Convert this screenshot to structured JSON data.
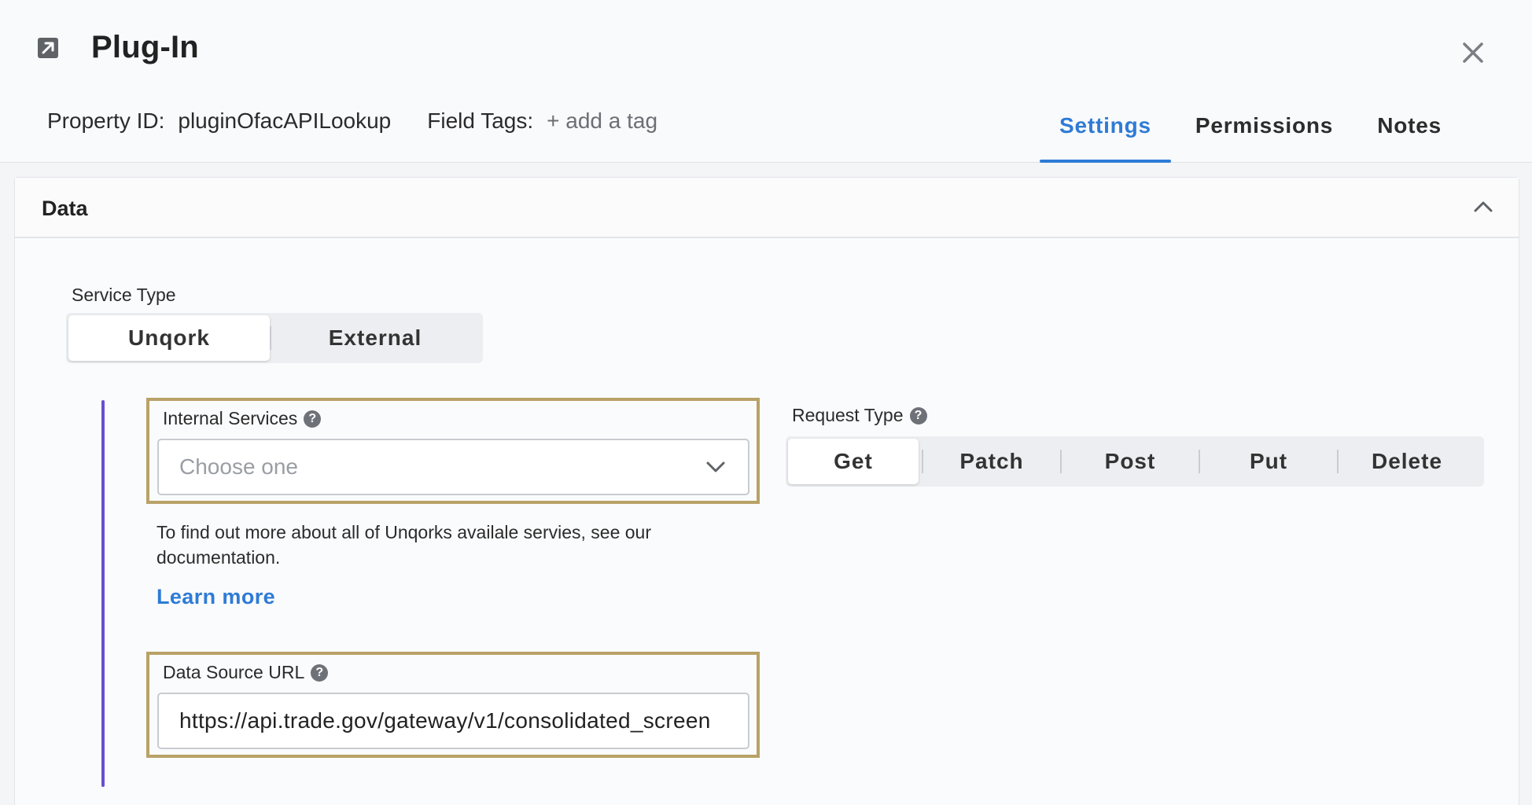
{
  "header": {
    "title": "Plug-In",
    "property_id_label": "Property ID:",
    "property_id_value": "pluginOfacAPILookup",
    "field_tags_label": "Field Tags:",
    "add_tag_label": "+ add a tag",
    "tabs": [
      {
        "label": "Settings",
        "active": true
      },
      {
        "label": "Permissions",
        "active": false
      },
      {
        "label": "Notes",
        "active": false
      }
    ]
  },
  "panel": {
    "title": "Data",
    "service_type": {
      "label": "Service Type",
      "options": [
        "Unqork",
        "External"
      ],
      "selected": "Unqork"
    },
    "internal_services": {
      "label": "Internal Services",
      "placeholder": "Choose one"
    },
    "help_text": "To find out more about all of Unqorks availale servies, see our documentation.",
    "learn_more": "Learn more",
    "data_source_url": {
      "label": "Data Source URL",
      "value": "https://api.trade.gov/gateway/v1/consolidated_screen"
    },
    "request_type": {
      "label": "Request Type",
      "options": [
        "Get",
        "Patch",
        "Post",
        "Put",
        "Delete"
      ],
      "selected": "Get"
    }
  },
  "colors": {
    "accent": "#2e7bd6",
    "highlight_border": "#b9a268",
    "indent_bar": "#6a4fcf"
  }
}
